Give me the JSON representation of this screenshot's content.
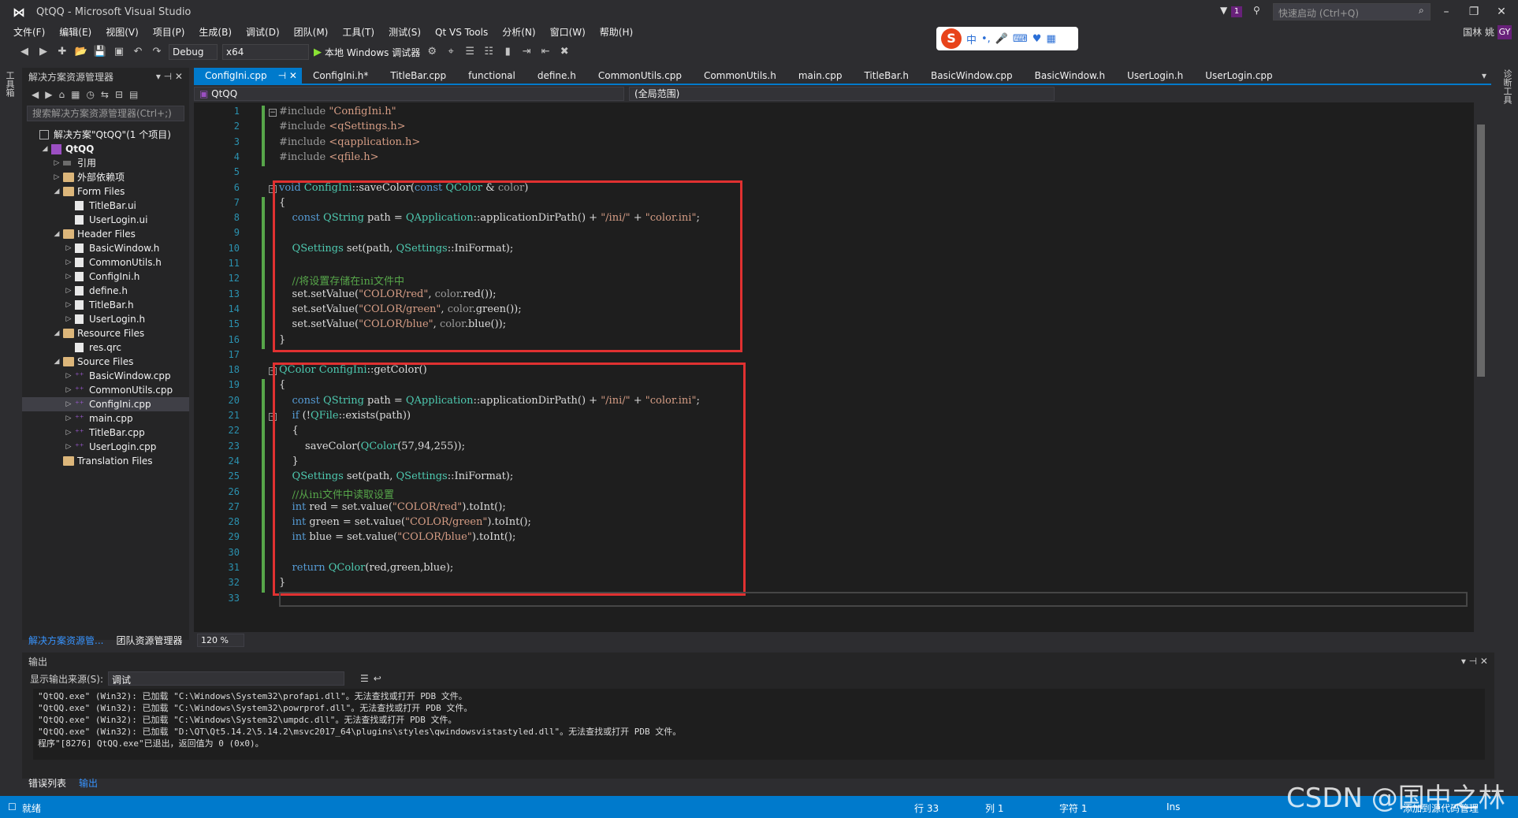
{
  "window": {
    "title": "QtQQ - Microsoft Visual Studio",
    "quick_launch": "快速启动 (Ctrl+Q)",
    "user": "国林 姚",
    "user_badge": "GY",
    "notif_count": "1"
  },
  "menu": [
    "文件(F)",
    "编辑(E)",
    "视图(V)",
    "项目(P)",
    "生成(B)",
    "调试(D)",
    "团队(M)",
    "工具(T)",
    "测试(S)",
    "Qt VS Tools",
    "分析(N)",
    "窗口(W)",
    "帮助(H)"
  ],
  "toolbar": {
    "config": "Debug",
    "platform": "x64",
    "run_label": "本地 Windows 调试器"
  },
  "ime": {
    "mode": "中"
  },
  "left_strip": "工具箱",
  "right_strip": "诊断工具",
  "solution_explorer": {
    "title": "解决方案资源管理器",
    "search_placeholder": "搜索解决方案资源管理器(Ctrl+;)",
    "tree": [
      {
        "label": "解决方案\"QtQQ\"(1 个项目)",
        "indent": 0,
        "arrow": "",
        "icon": "sol"
      },
      {
        "label": "QtQQ",
        "indent": 1,
        "arrow": "◢",
        "icon": "proj",
        "bold": true
      },
      {
        "label": "引用",
        "indent": 2,
        "arrow": "▷",
        "icon": "ref"
      },
      {
        "label": "外部依赖项",
        "indent": 2,
        "arrow": "▷",
        "icon": "folder"
      },
      {
        "label": "Form Files",
        "indent": 2,
        "arrow": "◢",
        "icon": "folder"
      },
      {
        "label": "TitleBar.ui",
        "indent": 3,
        "arrow": "",
        "icon": "file"
      },
      {
        "label": "UserLogin.ui",
        "indent": 3,
        "arrow": "",
        "icon": "file"
      },
      {
        "label": "Header Files",
        "indent": 2,
        "arrow": "◢",
        "icon": "folder"
      },
      {
        "label": "BasicWindow.h",
        "indent": 3,
        "arrow": "▷",
        "icon": "file"
      },
      {
        "label": "CommonUtils.h",
        "indent": 3,
        "arrow": "▷",
        "icon": "file"
      },
      {
        "label": "ConfigIni.h",
        "indent": 3,
        "arrow": "▷",
        "icon": "file"
      },
      {
        "label": "define.h",
        "indent": 3,
        "arrow": "▷",
        "icon": "file"
      },
      {
        "label": "TitleBar.h",
        "indent": 3,
        "arrow": "▷",
        "icon": "file"
      },
      {
        "label": "UserLogin.h",
        "indent": 3,
        "arrow": "▷",
        "icon": "file"
      },
      {
        "label": "Resource Files",
        "indent": 2,
        "arrow": "◢",
        "icon": "folder"
      },
      {
        "label": "res.qrc",
        "indent": 3,
        "arrow": "",
        "icon": "file"
      },
      {
        "label": "Source Files",
        "indent": 2,
        "arrow": "◢",
        "icon": "folder"
      },
      {
        "label": "BasicWindow.cpp",
        "indent": 3,
        "arrow": "▷",
        "icon": "cpp"
      },
      {
        "label": "CommonUtils.cpp",
        "indent": 3,
        "arrow": "▷",
        "icon": "cpp"
      },
      {
        "label": "ConfigIni.cpp",
        "indent": 3,
        "arrow": "▷",
        "icon": "cpp",
        "selected": true
      },
      {
        "label": "main.cpp",
        "indent": 3,
        "arrow": "▷",
        "icon": "cpp"
      },
      {
        "label": "TitleBar.cpp",
        "indent": 3,
        "arrow": "▷",
        "icon": "cpp"
      },
      {
        "label": "UserLogin.cpp",
        "indent": 3,
        "arrow": "▷",
        "icon": "cpp"
      },
      {
        "label": "Translation Files",
        "indent": 2,
        "arrow": "",
        "icon": "folder"
      }
    ],
    "bottom_tabs": [
      "解决方案资源管...",
      "团队资源管理器"
    ]
  },
  "editor": {
    "tabs": [
      "ConfigIni.cpp",
      "ConfigIni.h*",
      "TitleBar.cpp",
      "functional",
      "define.h",
      "CommonUtils.cpp",
      "CommonUtils.h",
      "main.cpp",
      "TitleBar.h",
      "BasicWindow.cpp",
      "BasicWindow.h",
      "UserLogin.h",
      "UserLogin.cpp"
    ],
    "nav_project": "QtQQ",
    "nav_scope": "(全局范围)",
    "zoom": "120 %",
    "lines": [
      [
        [
          "pp",
          "#include "
        ],
        [
          "str",
          "\"ConfigIni.h\""
        ]
      ],
      [
        [
          "pp",
          "#include "
        ],
        [
          "str",
          "<qSettings.h>"
        ]
      ],
      [
        [
          "pp",
          "#include "
        ],
        [
          "str",
          "<qapplication.h>"
        ]
      ],
      [
        [
          "pp",
          "#include "
        ],
        [
          "str",
          "<qfile.h>"
        ]
      ],
      [],
      [
        [
          "kw",
          "void "
        ],
        [
          "ty",
          "ConfigIni"
        ],
        [
          "fn",
          "::saveColor("
        ],
        [
          "kw",
          "const "
        ],
        [
          "ty",
          "QColor"
        ],
        [
          "fn",
          " & "
        ],
        [
          "pm",
          "color"
        ],
        [
          "fn",
          ")"
        ]
      ],
      [
        [
          "fn",
          "{"
        ]
      ],
      [
        [
          "fn",
          "    "
        ],
        [
          "kw",
          "const "
        ],
        [
          "ty",
          "QString"
        ],
        [
          "fn",
          " path = "
        ],
        [
          "ty",
          "QApplication"
        ],
        [
          "fn",
          "::applicationDirPath() + "
        ],
        [
          "str",
          "\"/ini/\""
        ],
        [
          "fn",
          " + "
        ],
        [
          "str",
          "\"color.ini\""
        ],
        [
          "fn",
          ";"
        ]
      ],
      [],
      [
        [
          "fn",
          "    "
        ],
        [
          "ty",
          "QSettings"
        ],
        [
          "fn",
          " set(path, "
        ],
        [
          "ty",
          "QSettings"
        ],
        [
          "fn",
          "::IniFormat);"
        ]
      ],
      [],
      [
        [
          "fn",
          "    "
        ],
        [
          "cm",
          "//将设置存储在ini文件中"
        ]
      ],
      [
        [
          "fn",
          "    set.setValue("
        ],
        [
          "str",
          "\"COLOR/red\""
        ],
        [
          "fn",
          ", "
        ],
        [
          "pm",
          "color"
        ],
        [
          "fn",
          ".red());"
        ]
      ],
      [
        [
          "fn",
          "    set.setValue("
        ],
        [
          "str",
          "\"COLOR/green\""
        ],
        [
          "fn",
          ", "
        ],
        [
          "pm",
          "color"
        ],
        [
          "fn",
          ".green());"
        ]
      ],
      [
        [
          "fn",
          "    set.setValue("
        ],
        [
          "str",
          "\"COLOR/blue\""
        ],
        [
          "fn",
          ", "
        ],
        [
          "pm",
          "color"
        ],
        [
          "fn",
          ".blue());"
        ]
      ],
      [
        [
          "fn",
          "}"
        ]
      ],
      [],
      [
        [
          "ty",
          "QColor "
        ],
        [
          "ty",
          "ConfigIni"
        ],
        [
          "fn",
          "::getColor()"
        ]
      ],
      [
        [
          "fn",
          "{"
        ]
      ],
      [
        [
          "fn",
          "    "
        ],
        [
          "kw",
          "const "
        ],
        [
          "ty",
          "QString"
        ],
        [
          "fn",
          " path = "
        ],
        [
          "ty",
          "QApplication"
        ],
        [
          "fn",
          "::applicationDirPath() + "
        ],
        [
          "str",
          "\"/ini/\""
        ],
        [
          "fn",
          " + "
        ],
        [
          "str",
          "\"color.ini\""
        ],
        [
          "fn",
          ";"
        ]
      ],
      [
        [
          "fn",
          "    "
        ],
        [
          "kw",
          "if "
        ],
        [
          "fn",
          "(!"
        ],
        [
          "ty",
          "QFile"
        ],
        [
          "fn",
          "::exists(path))"
        ]
      ],
      [
        [
          "fn",
          "    {"
        ]
      ],
      [
        [
          "fn",
          "        saveColor("
        ],
        [
          "ty",
          "QColor"
        ],
        [
          "fn",
          "(57,94,255));"
        ]
      ],
      [
        [
          "fn",
          "    }"
        ]
      ],
      [
        [
          "fn",
          "    "
        ],
        [
          "ty",
          "QSettings"
        ],
        [
          "fn",
          " set(path, "
        ],
        [
          "ty",
          "QSettings"
        ],
        [
          "fn",
          "::IniFormat);"
        ]
      ],
      [
        [
          "fn",
          "    "
        ],
        [
          "cm",
          "//从ini文件中读取设置"
        ]
      ],
      [
        [
          "fn",
          "    "
        ],
        [
          "kw",
          "int "
        ],
        [
          "fn",
          "red = set.value("
        ],
        [
          "str",
          "\"COLOR/red\""
        ],
        [
          "fn",
          ").toInt();"
        ]
      ],
      [
        [
          "fn",
          "    "
        ],
        [
          "kw",
          "int "
        ],
        [
          "fn",
          "green = set.value("
        ],
        [
          "str",
          "\"COLOR/green\""
        ],
        [
          "fn",
          ").toInt();"
        ]
      ],
      [
        [
          "fn",
          "    "
        ],
        [
          "kw",
          "int "
        ],
        [
          "fn",
          "blue = set.value("
        ],
        [
          "str",
          "\"COLOR/blue\""
        ],
        [
          "fn",
          ").toInt();"
        ]
      ],
      [],
      [
        [
          "fn",
          "    "
        ],
        [
          "kw",
          "return "
        ],
        [
          "ty",
          "QColor"
        ],
        [
          "fn",
          "(red,green,blue);"
        ]
      ],
      [
        [
          "fn",
          "}"
        ]
      ],
      []
    ]
  },
  "output": {
    "title": "输出",
    "source_label": "显示输出来源(S):",
    "source_value": "调试",
    "lines": [
      "\"QtQQ.exe\" (Win32): 已加载 \"C:\\Windows\\System32\\profapi.dll\"。无法查找或打开 PDB 文件。",
      "\"QtQQ.exe\" (Win32): 已加载 \"C:\\Windows\\System32\\powrprof.dll\"。无法查找或打开 PDB 文件。",
      "\"QtQQ.exe\" (Win32): 已加载 \"C:\\Windows\\System32\\umpdc.dll\"。无法查找或打开 PDB 文件。",
      "\"QtQQ.exe\" (Win32): 已加载 \"D:\\QT\\Qt5.14.2\\5.14.2\\msvc2017_64\\plugins\\styles\\qwindowsvistastyled.dll\"。无法查找或打开 PDB 文件。",
      "程序\"[8276] QtQQ.exe\"已退出，返回值为 0 (0x0)。"
    ],
    "bottom_tabs": [
      "错误列表",
      "输出"
    ]
  },
  "status": {
    "ready": "就绪",
    "line": "行 33",
    "col": "列 1",
    "char": "字符 1",
    "ins": "Ins",
    "source_control": "添加到源代码管理"
  },
  "watermark": "CSDN @国中之林"
}
